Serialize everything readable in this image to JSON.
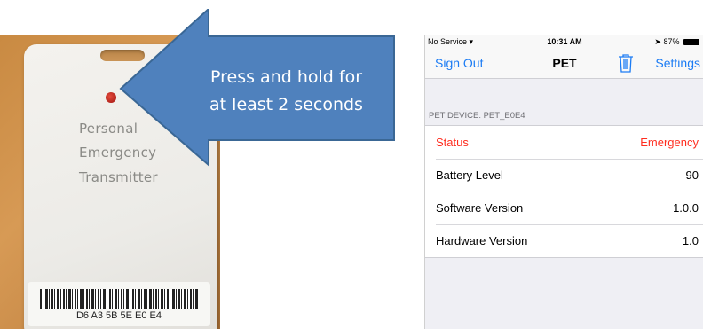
{
  "card": {
    "lines": [
      "Personal",
      "Emergency",
      "Transmitter"
    ],
    "barcode_text": "D6 A3 5B 5E E0 E4"
  },
  "callout": {
    "line1": "Press and hold for",
    "line2": "at least 2 seconds"
  },
  "phone": {
    "status_bar": {
      "carrier": "No Service",
      "time": "10:31 AM",
      "battery": "87%"
    },
    "nav": {
      "left_button": "Sign Out",
      "title": "PET",
      "right_button": "Settings",
      "trash_icon": "trash-icon"
    },
    "section_header": "PET DEVICE: PET_E0E4",
    "rows": [
      {
        "label": "Status",
        "value": "Emergency"
      },
      {
        "label": "Battery Level",
        "value": "90"
      },
      {
        "label": "Software Version",
        "value": "1.0.0"
      },
      {
        "label": "Hardware Version",
        "value": "1.0"
      }
    ]
  },
  "colors": {
    "ios_blue": "#1c7cf4",
    "alert_red": "#ff2d1f",
    "arrow_blue": "#4f81bd"
  }
}
